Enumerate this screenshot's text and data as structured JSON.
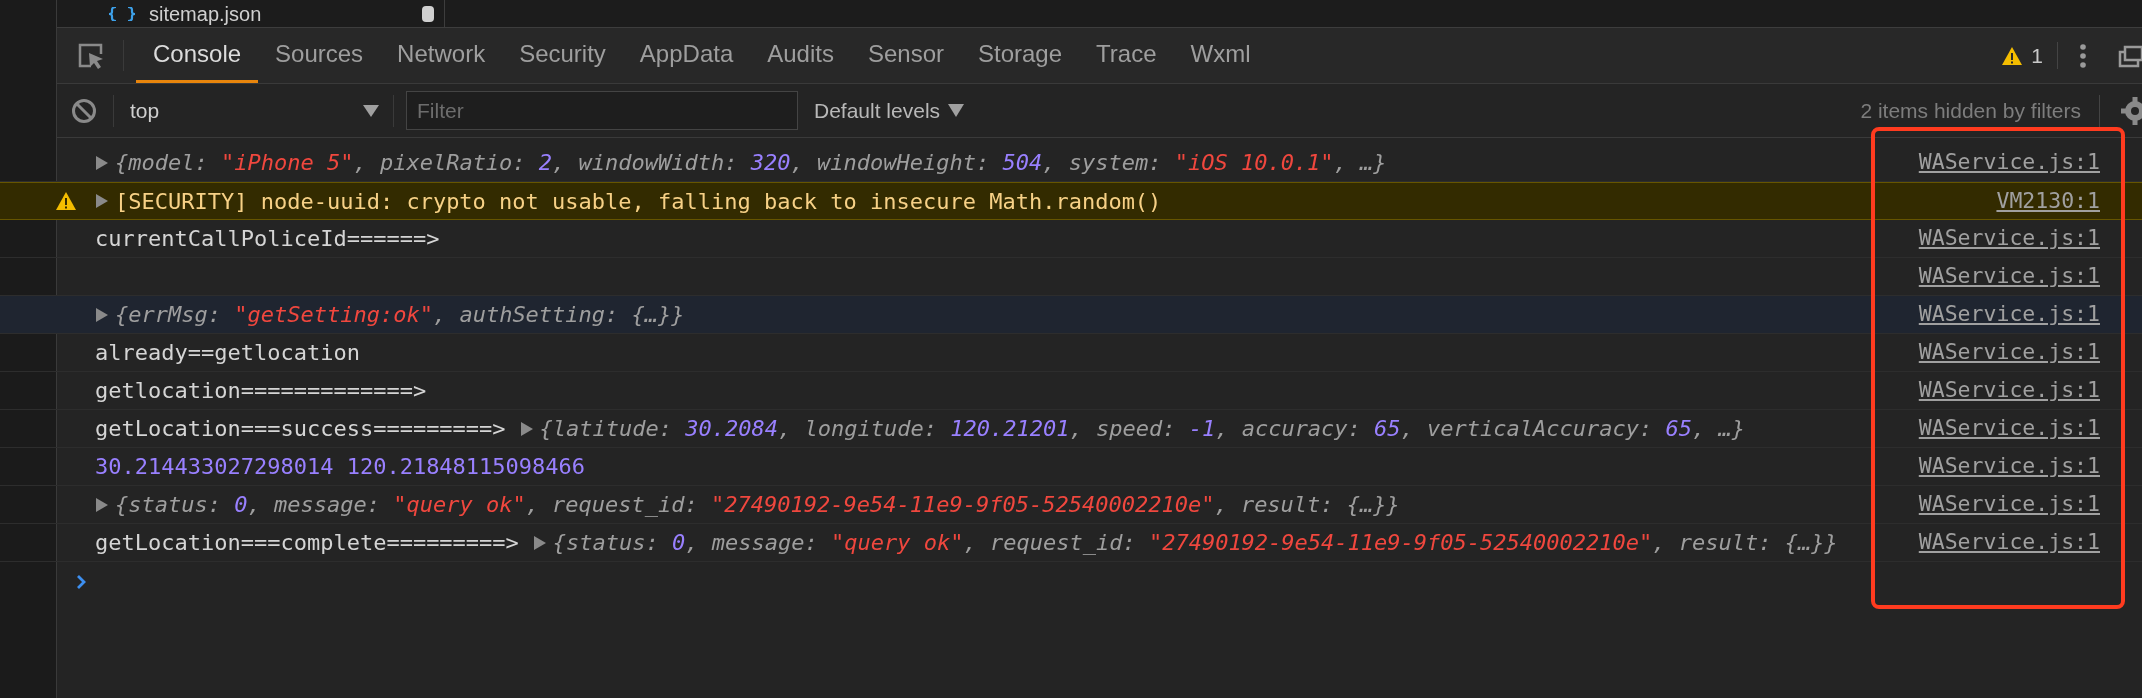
{
  "file_tab": {
    "name": "sitemap.json",
    "modified": true
  },
  "tabs": [
    {
      "label": "Console",
      "selected": true
    },
    {
      "label": "Sources",
      "selected": false
    },
    {
      "label": "Network",
      "selected": false
    },
    {
      "label": "Security",
      "selected": false
    },
    {
      "label": "AppData",
      "selected": false
    },
    {
      "label": "Audits",
      "selected": false
    },
    {
      "label": "Sensor",
      "selected": false
    },
    {
      "label": "Storage",
      "selected": false
    },
    {
      "label": "Trace",
      "selected": false
    },
    {
      "label": "Wxml",
      "selected": false
    }
  ],
  "warning_count": "1",
  "filter_bar": {
    "context": "top",
    "placeholder": "Filter",
    "levels": "Default levels",
    "hidden_note": "2 items hidden by filters"
  },
  "rows": [
    {
      "kind": "info",
      "selected": false,
      "expandable": true,
      "tokens": [
        {
          "kind": "key",
          "s": "{model: "
        },
        {
          "kind": "str",
          "s": "\"iPhone 5\""
        },
        {
          "kind": "key",
          "s": ", pixelRatio: "
        },
        {
          "kind": "num",
          "s": "2"
        },
        {
          "kind": "key",
          "s": ", windowWidth: "
        },
        {
          "kind": "num",
          "s": "320"
        },
        {
          "kind": "key",
          "s": ", windowHeight: "
        },
        {
          "kind": "num",
          "s": "504"
        },
        {
          "kind": "key",
          "s": ", system: "
        },
        {
          "kind": "str",
          "s": "\"iOS 10.0.1\""
        },
        {
          "kind": "key",
          "s": ", …}"
        }
      ],
      "source": "WAService.js:1"
    },
    {
      "kind": "warning",
      "selected": false,
      "text": "[SECURITY] node-uuid: crypto not usable, falling back to insecure Math.random()",
      "expandable": true,
      "tokens": [],
      "source": "VM2130:1"
    },
    {
      "kind": "info",
      "selected": false,
      "text": "currentCallPoliceId======>",
      "expandable": false,
      "tokens": [],
      "source": "WAService.js:1"
    },
    {
      "kind": "info",
      "selected": false,
      "expandable": false,
      "tokens": [],
      "source": "WAService.js:1"
    },
    {
      "kind": "info",
      "selected": true,
      "expandable": true,
      "tokens": [
        {
          "kind": "key",
          "s": "{errMsg: "
        },
        {
          "kind": "str",
          "s": "\"getSetting:ok\""
        },
        {
          "kind": "key",
          "s": ", authSetting: {…}}"
        }
      ],
      "source": "WAService.js:1"
    },
    {
      "kind": "info",
      "selected": false,
      "text": "already==getlocation",
      "expandable": false,
      "tokens": [],
      "source": "WAService.js:1"
    },
    {
      "kind": "info",
      "selected": false,
      "text": "getlocation=============>",
      "expandable": false,
      "tokens": [],
      "source": "WAService.js:1"
    },
    {
      "kind": "info",
      "selected": false,
      "text": "getLocation===success=========>",
      "expandable": true,
      "tokens": [
        {
          "kind": "key",
          "s": "{latitude: "
        },
        {
          "kind": "num",
          "s": "30.2084"
        },
        {
          "kind": "key",
          "s": ", longitude: "
        },
        {
          "kind": "num",
          "s": "120.21201"
        },
        {
          "kind": "key",
          "s": ", speed: "
        },
        {
          "kind": "num",
          "s": "-1"
        },
        {
          "kind": "key",
          "s": ", accuracy: "
        },
        {
          "kind": "num",
          "s": "65"
        },
        {
          "kind": "key",
          "s": ", verticalAccuracy: "
        },
        {
          "kind": "num",
          "s": "65"
        },
        {
          "kind": "key",
          "s": ", …}"
        }
      ],
      "source": "WAService.js:1"
    },
    {
      "kind": "number",
      "selected": false,
      "text": "30.214433027298014 120.21848115098466",
      "expandable": false,
      "tokens": [],
      "source": "WAService.js:1"
    },
    {
      "kind": "info",
      "selected": false,
      "expandable": true,
      "tokens": [
        {
          "kind": "key",
          "s": "{status: "
        },
        {
          "kind": "num",
          "s": "0"
        },
        {
          "kind": "key",
          "s": ", message: "
        },
        {
          "kind": "str",
          "s": "\"query ok\""
        },
        {
          "kind": "key",
          "s": ", request_id: "
        },
        {
          "kind": "str",
          "s": "\"27490192-9e54-11e9-9f05-52540002210e\""
        },
        {
          "kind": "key",
          "s": ", result: {…}}"
        }
      ],
      "source": "WAService.js:1"
    },
    {
      "kind": "info",
      "selected": false,
      "text": "getLocation===complete=========>",
      "expandable": true,
      "tokens": [
        {
          "kind": "key",
          "s": "{status: "
        },
        {
          "kind": "num",
          "s": "0"
        },
        {
          "kind": "key",
          "s": ", message: "
        },
        {
          "kind": "str",
          "s": "\"query ok\""
        },
        {
          "kind": "key",
          "s": ", request_id: "
        },
        {
          "kind": "str",
          "s": "\"27490192-9e54-11e9-9f05-52540002210e\""
        },
        {
          "kind": "key",
          "s": ", result: {…}}"
        }
      ],
      "source": "WAService.js:1"
    }
  ],
  "annotation_frame": {
    "shown": true
  }
}
